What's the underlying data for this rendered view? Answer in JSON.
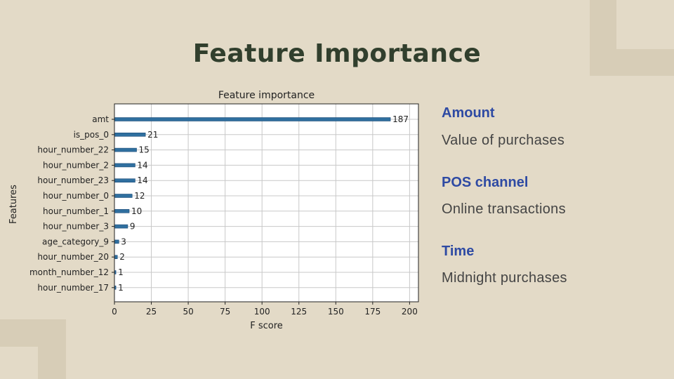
{
  "slide": {
    "title": "Feature Importance",
    "colors": {
      "background": "#e3dac7",
      "deco": "#d6ccb6",
      "title": "#313f2d",
      "accent": "#2e4aa3",
      "bar": "#2f6f9f"
    }
  },
  "chart_data": {
    "type": "bar",
    "orientation": "horizontal",
    "title": "Feature importance",
    "xlabel": "F score",
    "ylabel": "Features",
    "categories": [
      "amt",
      "is_pos_0",
      "hour_number_22",
      "hour_number_2",
      "hour_number_23",
      "hour_number_0",
      "hour_number_1",
      "hour_number_3",
      "age_category_9",
      "hour_number_20",
      "month_number_12",
      "hour_number_17"
    ],
    "values": [
      187,
      21,
      15,
      14,
      14,
      12,
      10,
      9,
      3,
      2,
      1,
      1
    ],
    "xlim": [
      0,
      206
    ],
    "xticks": [
      0,
      25,
      50,
      75,
      100,
      125,
      150,
      175,
      200
    ],
    "grid": true,
    "data_labels": true
  },
  "sidebar": {
    "items": [
      {
        "heading": "Amount",
        "text": "Value of purchases"
      },
      {
        "heading": "POS channel",
        "text": "Online transactions"
      },
      {
        "heading": "Time",
        "text": "Midnight purchases"
      }
    ]
  }
}
